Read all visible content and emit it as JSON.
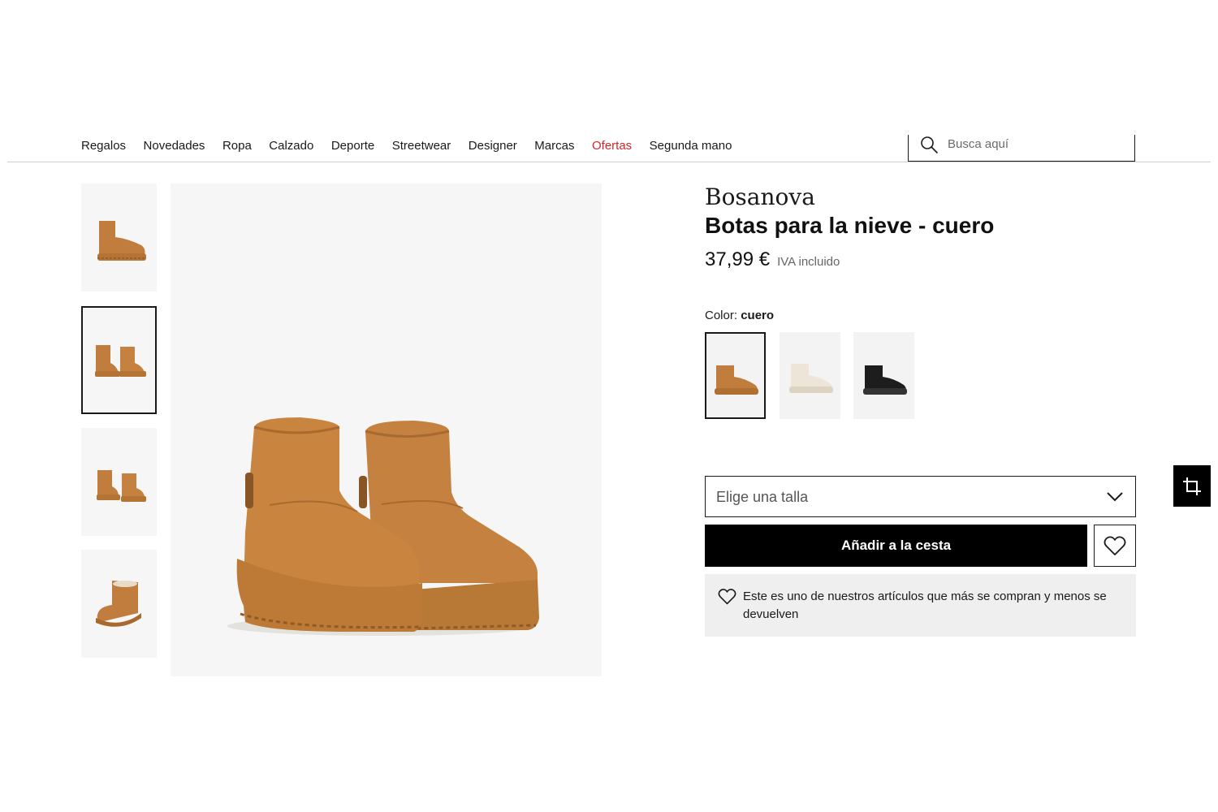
{
  "nav": {
    "items": [
      "Regalos",
      "Novedades",
      "Ropa",
      "Calzado",
      "Deporte",
      "Streetwear",
      "Designer",
      "Marcas",
      "Ofertas",
      "Segunda mano"
    ],
    "sale_color": "#d3262a"
  },
  "search": {
    "placeholder": "Busca aquí",
    "icon": "search-icon"
  },
  "product": {
    "brand": "Bosanova",
    "name": "Botas para la nieve - cuero",
    "price": "37,99 €",
    "vat_note": "IVA incluido",
    "color_label": "Color:",
    "color_value": "cuero",
    "colors": [
      {
        "name": "cuero",
        "hex": "#c07d3e",
        "selected": true
      },
      {
        "name": "beige",
        "hex": "#ece5d8",
        "selected": false
      },
      {
        "name": "negro",
        "hex": "#1d1d1d",
        "selected": false
      }
    ],
    "size_placeholder": "Elige una talla",
    "add_to_cart": "Añadir a la cesta",
    "info_message": "Este es uno de nuestros artículos que más se compran y menos se devuelven"
  },
  "gallery": {
    "thumbnails": 4,
    "active_thumbnail": 2
  },
  "colors": {
    "accent": "#000000",
    "image_bg": "#f6f6f6",
    "info_bg": "#efefef"
  }
}
